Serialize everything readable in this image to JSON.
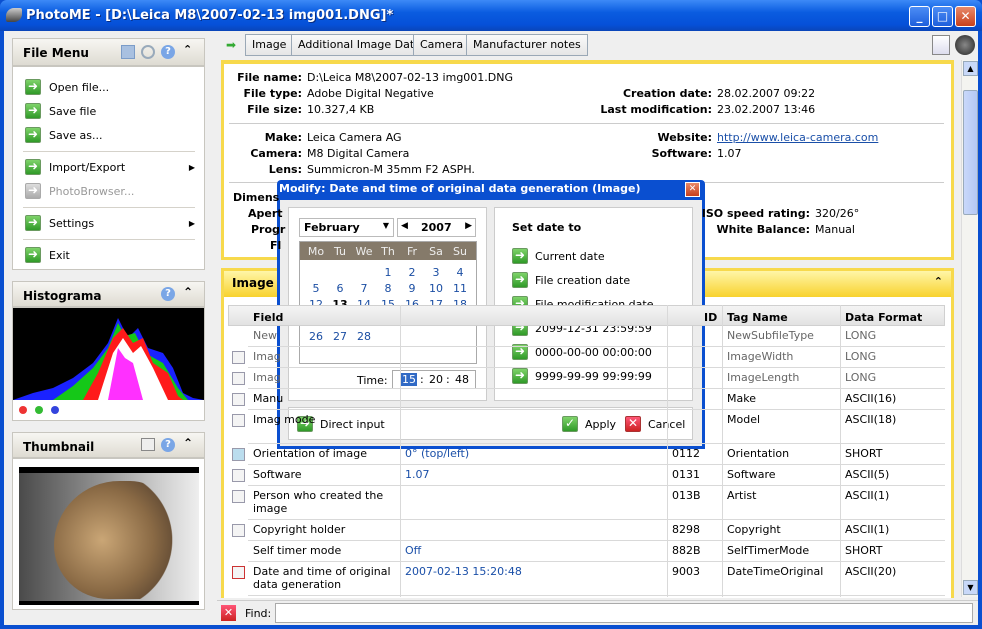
{
  "window": {
    "title": "PhotoME - [D:\\Leica M8\\2007-02-13 img001.DNG]*",
    "minimize": "_",
    "maximize": "□",
    "close": "✕"
  },
  "file_menu": {
    "title": "File Menu",
    "items": [
      {
        "label": "Open file...",
        "enabled": true
      },
      {
        "label": "Save file",
        "enabled": true
      },
      {
        "label": "Save as...",
        "enabled": true
      },
      {
        "label": "Import/Export",
        "enabled": true,
        "submenu": true
      },
      {
        "label": "PhotoBrowser...",
        "enabled": false
      },
      {
        "label": "Settings",
        "enabled": true,
        "submenu": true
      },
      {
        "label": "Exit",
        "enabled": true
      }
    ]
  },
  "histogram": {
    "title": "Histograma"
  },
  "thumbnail": {
    "title": "Thumbnail"
  },
  "tabs": [
    "Image",
    "Additional Image Data",
    "Camera",
    "Manufacturer notes"
  ],
  "info": {
    "file_name_label": "File name:",
    "file_name": "D:\\Leica M8\\2007-02-13 img001.DNG",
    "file_type_label": "File type:",
    "file_type": "Adobe Digital Negative",
    "file_size_label": "File size:",
    "file_size": "10.327,4 KB",
    "creation_label": "Creation date:",
    "creation": "28.02.2007 09:22",
    "lastmod_label": "Last modification:",
    "lastmod": "23.02.2007 13:46",
    "make_label": "Make:",
    "make": "Leica Camera AG",
    "camera_label": "Camera:",
    "camera": "M8 Digital Camera",
    "lens_label": "Lens:",
    "lens": "Summicron-M 35mm F2 ASPH.",
    "website_label": "Website:",
    "website": "http://www.leica-camera.com",
    "software_label": "Software:",
    "software": "1.07",
    "hidden_labels": [
      "Dimens",
      "Apert",
      "Progr",
      "Fl"
    ],
    "iso_label": "ISO speed rating:",
    "iso": "320/26°",
    "wb_label": "White Balance:",
    "wb": "Manual"
  },
  "section": {
    "title": "Image"
  },
  "table": {
    "headers": [
      "Field",
      "ID",
      "Tag Name",
      "Data Format"
    ],
    "rows": [
      {
        "field": "New",
        "value": "",
        "id": "",
        "tag": "NewSubfileType",
        "format": "LONG",
        "dim": true
      },
      {
        "field": "Imag",
        "value": "",
        "id": "",
        "tag": "ImageWidth",
        "format": "LONG",
        "dim": true,
        "icon": "width-icon"
      },
      {
        "field": "Imag",
        "value": "",
        "id": "",
        "tag": "ImageLength",
        "format": "LONG",
        "dim": true,
        "icon": "height-icon"
      },
      {
        "field": "Manu",
        "value": "",
        "id": "",
        "tag": "Make",
        "format": "ASCII(16)",
        "icon": "text-field-icon"
      },
      {
        "field": "Imag mode",
        "value": "",
        "id": "",
        "tag": "Model",
        "format": "ASCII(18)",
        "icon": "text-field-icon",
        "tall": true
      },
      {
        "field": "Orientation of image",
        "value": "0° (top/left)",
        "id": "0112",
        "tag": "Orientation",
        "format": "SHORT",
        "icon": "orientation-icon"
      },
      {
        "field": "Software",
        "value": "1.07",
        "id": "0131",
        "tag": "Software",
        "format": "ASCII(5)",
        "icon": "text-field-icon"
      },
      {
        "field": "Person who created the image",
        "value": "",
        "id": "013B",
        "tag": "Artist",
        "format": "ASCII(1)",
        "icon": "text-field-icon",
        "tall": true
      },
      {
        "field": "Copyright holder",
        "value": "",
        "id": "8298",
        "tag": "Copyright",
        "format": "ASCII(1)",
        "icon": "text-field-icon"
      },
      {
        "field": "Self timer mode",
        "value": "Off",
        "id": "882B",
        "tag": "SelfTimerMode",
        "format": "SHORT"
      },
      {
        "field": "Date and time of original data generation",
        "value": "2007-02-13 15:20:48",
        "id": "9003",
        "tag": "DateTimeOriginal",
        "format": "ASCII(20)",
        "icon": "calendar-icon",
        "tall": true
      }
    ]
  },
  "find": {
    "label": "Find:",
    "value": ""
  },
  "dialog": {
    "title": "Modify: Date and time of original data generation (Image)",
    "month": "February",
    "year": "2007",
    "weekdays": [
      "Mo",
      "Tu",
      "We",
      "Th",
      "Fr",
      "Sa",
      "Su"
    ],
    "first_weekday": 3,
    "days_in_month": 28,
    "selected_day": 13,
    "time_label": "Time:",
    "hour": "15",
    "minute": "20",
    "second": "48",
    "set_date_title": "Set date to",
    "options": [
      "Current date",
      "File creation date",
      "File modification date",
      "2099-12-31 23:59:59",
      "0000-00-00 00:00:00",
      "9999-99-99 99:99:99"
    ],
    "direct_input": "Direct input",
    "apply": "Apply",
    "cancel": "Cancel"
  },
  "colors": {
    "titlebar": "#0a5ce0",
    "accent_yellow": "#f7d94c",
    "link": "#1a4fa8",
    "calendar_header": "#857a6a"
  }
}
